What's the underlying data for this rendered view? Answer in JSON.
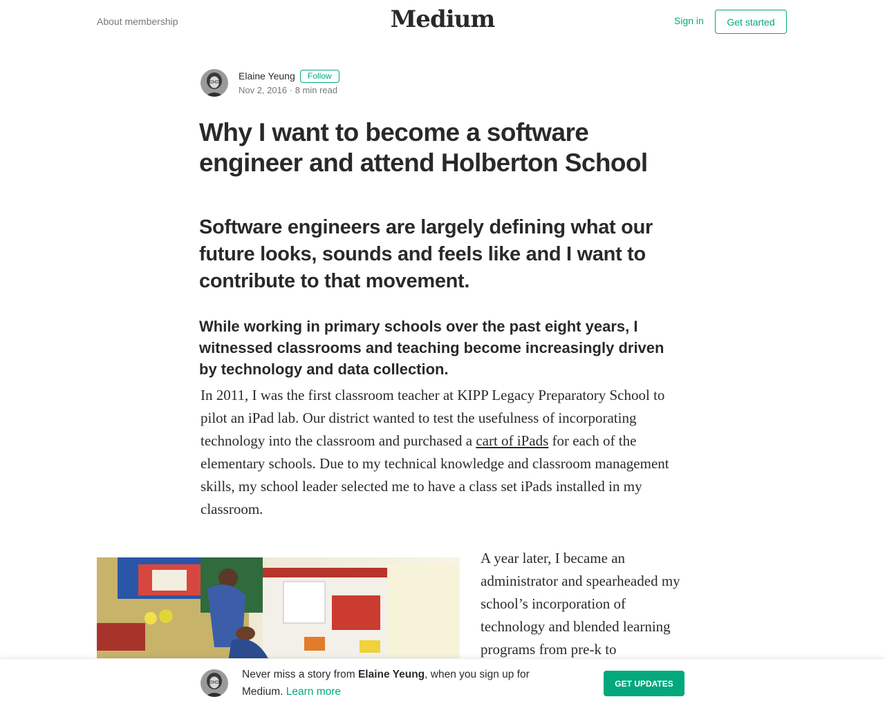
{
  "header": {
    "about_label": "About membership",
    "logo_text": "Medium",
    "signin_label": "Sign in",
    "getstarted_label": "Get started"
  },
  "author": {
    "name": "Elaine Yeung",
    "follow_label": "Follow",
    "date": "Nov 2, 2016",
    "separator": "·",
    "read_time": "8 min read"
  },
  "article": {
    "title": "Why I want to become a software engineer and attend Holberton School",
    "subtitle": "Software engineers are largely defining what our future looks, sounds and feels like and I want to contribute to that movement.",
    "kicker": "While working in primary schools over the past eight years, I witnessed classrooms and teaching become increasingly driven by technology and data collection.",
    "p1_before": "In 2011, I was the first classroom teacher at KIPP Legacy Preparatory School to pilot an iPad lab. Our district wanted to test the usefulness of incorporating technology into the classroom and purchased a ",
    "p1_link": "cart of iPads",
    "p1_after": " for each of the elementary schools. Due to my technical knowledge and classroom management skills, my school leader selected me to have a class set iPads installed in my classroom.",
    "p2": "A year later, I became an administrator and spearheaded my school’s incorporation of technology and blended learning programs from pre-k to"
  },
  "bottom_bar": {
    "text_before": "Never miss a story from ",
    "author": "Elaine Yeung",
    "text_after": ", when you sign up for Medium. ",
    "learn_more": "Learn more",
    "button_label": "GET UPDATES"
  },
  "colors": {
    "accent": "#03a87c",
    "text": "#292929",
    "muted": "#757575"
  }
}
